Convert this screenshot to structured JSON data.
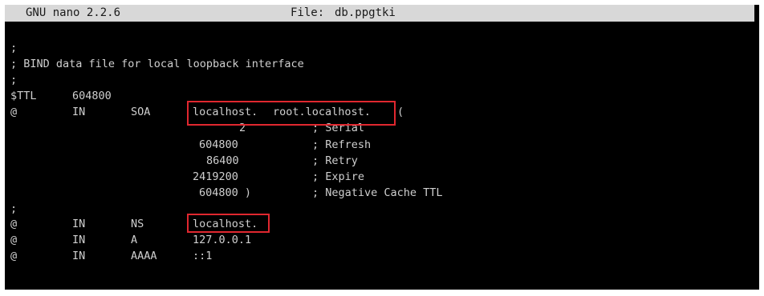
{
  "title_bar": {
    "app_version": "GNU nano 2.2.6",
    "file_label": "File:",
    "file_name": "db.ppgtki"
  },
  "buffer": {
    "comment_blank_1": ";",
    "comment_header": "; BIND data file for local loopback interface",
    "comment_blank_2": ";",
    "ttl_directive": "$TTL",
    "ttl_value": "604800",
    "soa": {
      "name": "@",
      "class": "IN",
      "type": "SOA",
      "primary_ns": "localhost.",
      "admin_email": "root.localhost.",
      "open_paren": "(",
      "serial_value": "2",
      "serial_comment": "; Serial",
      "refresh_value": "604800",
      "refresh_comment": "; Refresh",
      "retry_value": "86400",
      "retry_comment": "; Retry",
      "expire_value": "2419200",
      "expire_comment": "; Expire",
      "negative_ttl_value": "604800 )",
      "negative_ttl_comment": "; Negative Cache TTL"
    },
    "comment_blank_3": ";",
    "ns_record": {
      "name": "@",
      "class": "IN",
      "type": "NS",
      "value": "localhost."
    },
    "a_record": {
      "name": "@",
      "class": "IN",
      "type": "A",
      "value": "127.0.0.1"
    },
    "aaaa_record": {
      "name": "@",
      "class": "IN",
      "type": "AAAA",
      "value": "::1"
    }
  },
  "colors": {
    "terminal_bg": "#000000",
    "terminal_text": "#cfcfcf",
    "title_bar_bg": "#d8d8d8",
    "title_bar_text": "#1a1a1a",
    "highlight_box": "#e0272f"
  }
}
